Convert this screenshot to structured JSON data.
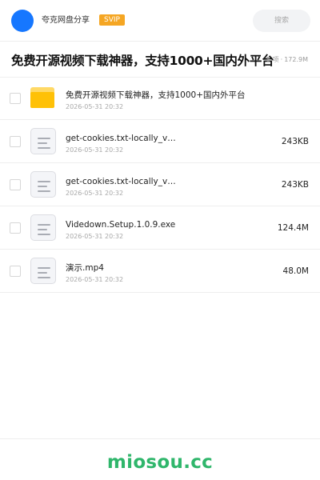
{
  "header": {
    "username": "夸克网盘分享",
    "badge": "SVIP",
    "search_placeholder": "搜索"
  },
  "share": {
    "title": "免费开源视频下载神器，支持1000+国内外平台",
    "item_count": "5 项",
    "total_size": "172.9M"
  },
  "files": [
    {
      "type": "folder",
      "icon": "folder-icon",
      "name": "免费开源视频下载神器，支持1000+国内外平台",
      "date": "2026-05-31 20:32",
      "size": ""
    },
    {
      "type": "file",
      "icon": "file-icon",
      "name": "get-cookies.txt-locally_v…",
      "date": "2026-05-31 20:32",
      "size": "243KB"
    },
    {
      "type": "file",
      "icon": "file-icon",
      "name": "get-cookies.txt-locally_v…",
      "date": "2026-05-31 20:32",
      "size": "243KB"
    },
    {
      "type": "file",
      "icon": "file-icon",
      "name": "Videdown.Setup.1.0.9.exe",
      "date": "2026-05-31 20:32",
      "size": "124.4M"
    },
    {
      "type": "file",
      "icon": "file-icon",
      "name": "演示.mp4",
      "date": "2026-05-31 20:32",
      "size": "48.0M"
    }
  ],
  "watermark": "miosou.cc",
  "colors": {
    "avatar": "#1677ff",
    "badge": "#f5a623",
    "folder": "#ffc107",
    "watermark": "#2fb66b"
  }
}
